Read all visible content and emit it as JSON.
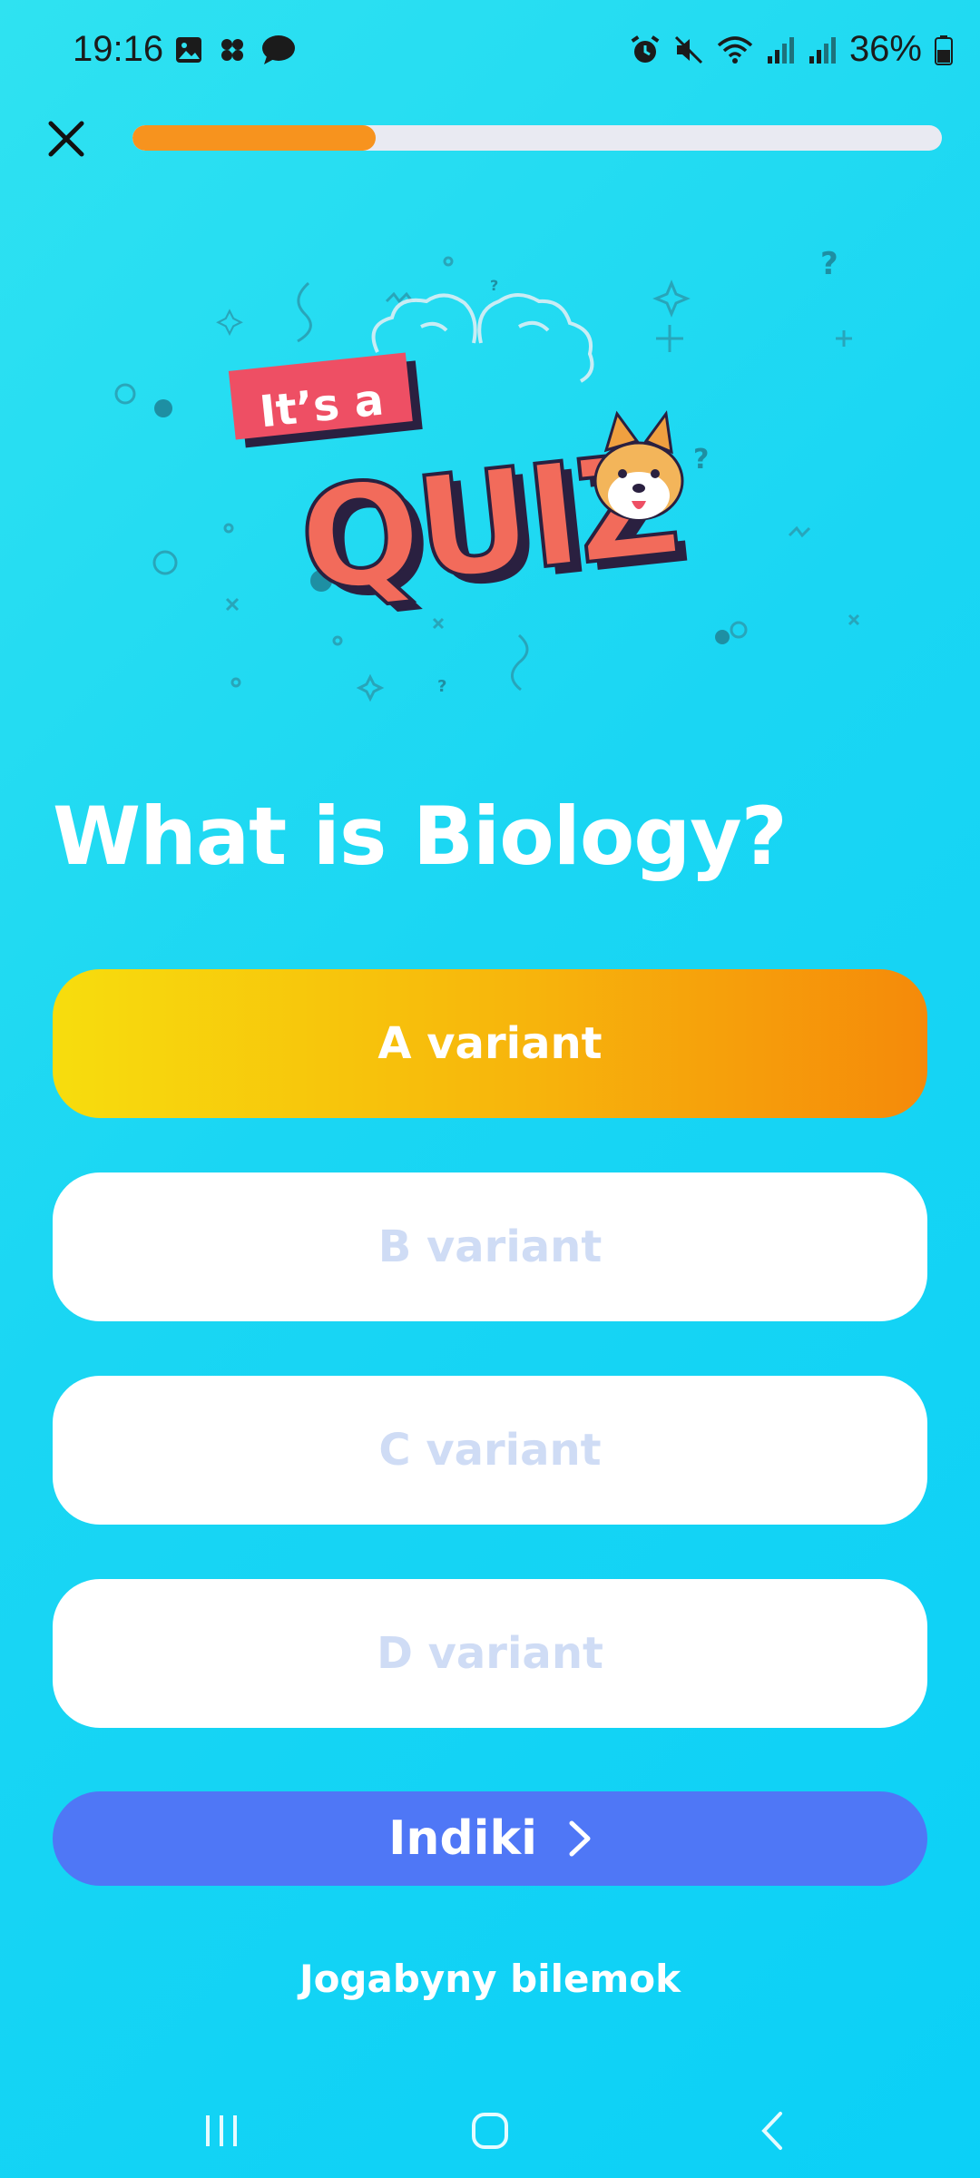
{
  "status": {
    "time": "19:16",
    "battery": "36%",
    "left_icons": [
      "gallery-icon",
      "pinwheel-icon",
      "chat-icon"
    ],
    "right_icons": [
      "alarm-icon",
      "mute-icon",
      "wifi-icon",
      "signal-icon",
      "signal-icon",
      "battery-icon"
    ]
  },
  "progress": {
    "fraction": 0.3
  },
  "illustration": {
    "banner_text": "It’s a",
    "title_text": "QUIZ"
  },
  "question": "What is Biology?",
  "answers": [
    {
      "label": "A variant",
      "selected": true
    },
    {
      "label": "B variant",
      "selected": false
    },
    {
      "label": "C variant",
      "selected": false
    },
    {
      "label": "D variant",
      "selected": false
    }
  ],
  "next_label": "Indiki",
  "show_answer_label": "Jogabyny bilemok",
  "colors": {
    "background": "#1ad6f3",
    "progress": "#f7931e",
    "next_button": "#4f77f6",
    "selected_start": "#f7dd0d",
    "selected_end": "#f58a0a",
    "unselected_text": "#cfdcf5"
  },
  "nav": [
    "recent-apps-icon",
    "home-icon",
    "back-icon"
  ]
}
